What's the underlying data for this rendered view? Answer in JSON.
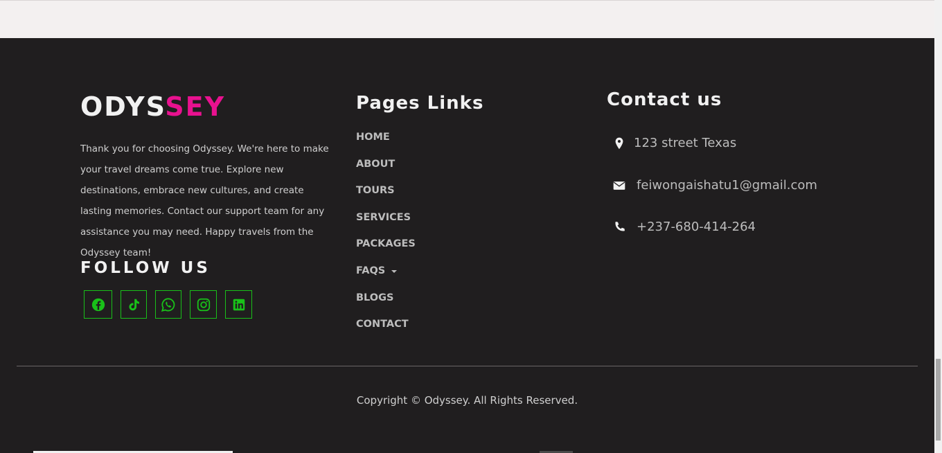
{
  "brand": {
    "part1": "ODYS",
    "part2": "SEY"
  },
  "about_text": "Thank you for choosing Odyssey. We're here to make your travel dreams come true. Explore new destinations, embrace new cultures, and create lasting memories. Contact our support team for any assistance you may need. Happy travels from the Odyssey team!",
  "follow_title": "FOLLOW US",
  "social": [
    {
      "icon": "facebook-icon"
    },
    {
      "icon": "tiktok-icon"
    },
    {
      "icon": "whatsapp-icon"
    },
    {
      "icon": "instagram-icon"
    },
    {
      "icon": "linkedin-icon"
    }
  ],
  "pages": {
    "title": "Pages Links",
    "links": [
      "HOME",
      "ABOUT",
      "TOURS",
      "SERVICES",
      "PACKAGES",
      "FAQS",
      "BLOGS",
      "CONTACT"
    ]
  },
  "contact": {
    "title": "Contact us",
    "address": "123 street Texas",
    "email": "feiwongaishatu1@gmail.com",
    "phone": "+237-680-414-264"
  },
  "copyright": "Copyright © Odyssey. All Rights Reserved.",
  "colors": {
    "background": "#201e1f",
    "brand_accent": "#e8118f",
    "social_green": "#19c119",
    "top_strip": "#f3f0f0"
  }
}
